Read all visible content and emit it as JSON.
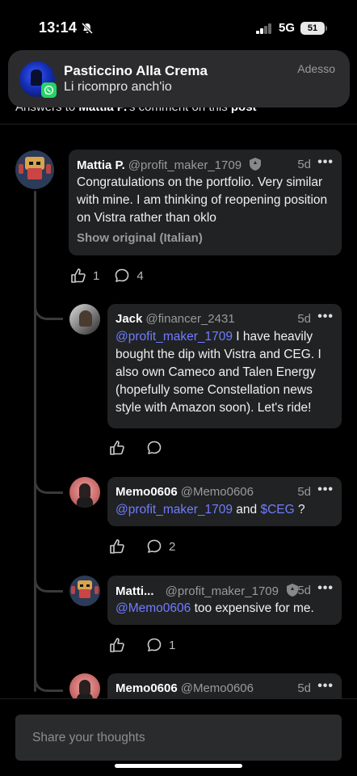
{
  "status_bar": {
    "time": "13:14",
    "network": "5G",
    "battery": "51"
  },
  "header": {
    "prefix": "Answers to ",
    "user": "Mattia P.",
    "middle": "'s comment on this ",
    "link": "post"
  },
  "notification": {
    "app_icon": "whatsapp-icon",
    "title": "Pasticcino Alla Crema",
    "message": "Li ricompro anch'io",
    "time": "Adesso"
  },
  "comments": [
    {
      "name": "Mattia P.",
      "handle": "@profit_maker_1709",
      "time": "5d",
      "text": "Congratulations on the portfolio. Very similar with mine. I am thinking of reopening position on Vistra rather than oklo",
      "show_original": "Show original (Italian)",
      "likes": "1",
      "replies": "4"
    },
    {
      "name": "Jack",
      "handle": "@financer_2431",
      "time": "5d",
      "mention": "@profit_maker_1709",
      "text": " I have heavily bought the dip with Vistra and CEG. I also own Cameco and Talen Energy (hopefully some Constellation news style with Amazon soon). Let's ride!",
      "likes": "",
      "replies": ""
    },
    {
      "name": "Memo0606",
      "handle": "@Memo0606",
      "time": "5d",
      "mention": "@profit_maker_1709",
      "middle": " and ",
      "ticker": "$CEG",
      "tail": " ?",
      "likes": "",
      "replies": "2"
    },
    {
      "name": "Matti...",
      "handle": "@profit_maker_1709",
      "time": "5d",
      "mention": "@Memo0606",
      "text": " too expensive for me.",
      "likes": "",
      "replies": "1"
    },
    {
      "name": "Memo0606",
      "handle": "@Memo0606",
      "time": "5d"
    }
  ],
  "composer": {
    "placeholder": "Share your thoughts"
  },
  "more_label": "•••"
}
